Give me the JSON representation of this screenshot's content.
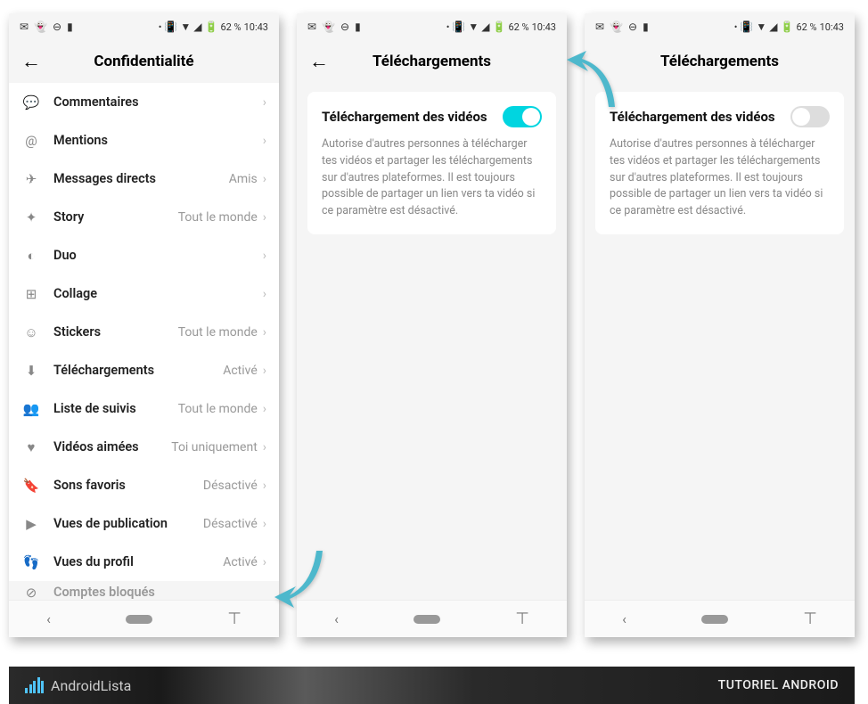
{
  "statusbar": {
    "battery": "62 %",
    "time": "10:43",
    "battery2": "62 %"
  },
  "phone1": {
    "title": "Confidentialité",
    "rows": [
      {
        "icon": "💬",
        "label": "Commentaires",
        "value": ""
      },
      {
        "icon": "@",
        "label": "Mentions",
        "value": ""
      },
      {
        "icon": "✈",
        "label": "Messages directs",
        "value": "Amis"
      },
      {
        "icon": "✦",
        "label": "Story",
        "value": "Tout le monde"
      },
      {
        "icon": "◐",
        "label": "Duo",
        "value": ""
      },
      {
        "icon": "⊞",
        "label": "Collage",
        "value": ""
      },
      {
        "icon": "☺",
        "label": "Stickers",
        "value": "Tout le monde"
      },
      {
        "icon": "⬇",
        "label": "Téléchargements",
        "value": "Activé"
      },
      {
        "icon": "👥",
        "label": "Liste de suivis",
        "value": "Tout le monde"
      },
      {
        "icon": "♥",
        "label": "Vidéos aimées",
        "value": "Toi uniquement"
      },
      {
        "icon": "🔖",
        "label": "Sons favoris",
        "value": "Désactivé"
      },
      {
        "icon": "▶",
        "label": "Vues de publication",
        "value": "Désactivé"
      },
      {
        "icon": "👣",
        "label": "Vues du profil",
        "value": "Activé"
      }
    ],
    "cutRow": {
      "icon": "⊘",
      "label": "Comptes bloqués"
    }
  },
  "phone2": {
    "title": "Téléchargements",
    "card": {
      "title": "Téléchargement des vidéos",
      "desc": "Autorise d'autres personnes à télécharger tes vidéos et partager les téléchargements sur d'autres plateformes. Il est toujours possible de partager un lien vers ta vidéo si ce paramètre est désactivé.",
      "toggle": "on"
    }
  },
  "phone3": {
    "title": "Téléchargements",
    "card": {
      "title": "Téléchargement des vidéos",
      "desc": "Autorise d'autres personnes à télécharger tes vidéos et partager les téléchargements sur d'autres plateformes. Il est toujours possible de partager un lien vers ta vidéo si ce paramètre est désactivé.",
      "toggle": "off"
    }
  },
  "footer": {
    "brand": "AndroidLista",
    "right": "TUTORIEL ANDROID"
  }
}
